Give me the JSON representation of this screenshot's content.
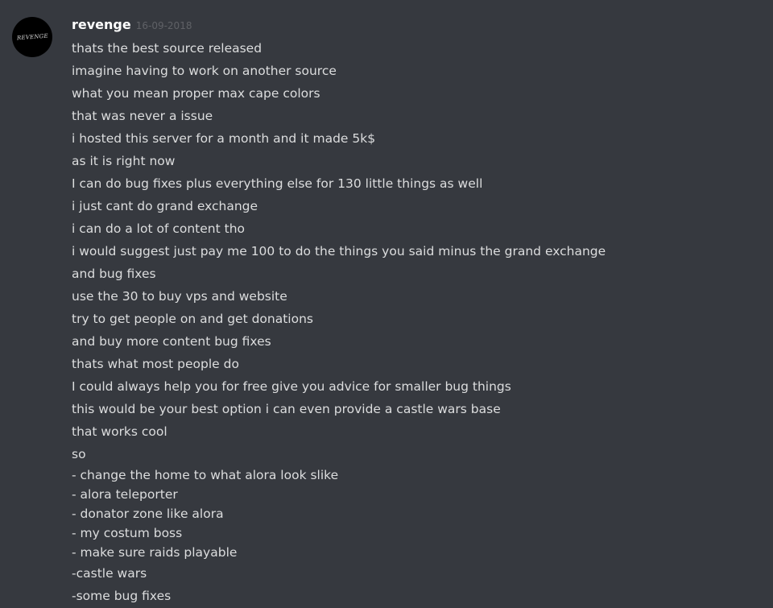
{
  "message": {
    "username": "revenge",
    "timestamp": "16-09-2018",
    "avatar_logo_text": "REVENGE",
    "lines": [
      "thats the best source released",
      "imagine having to work on another source",
      "what you mean proper max cape colors",
      "that was never a issue",
      "i hosted this server for a month and it made 5k$",
      "as it is right now",
      "I can do bug fixes plus everything else for 130 little things as well",
      "i just cant do grand exchange",
      "i can do a lot of content tho",
      "i would suggest just pay me 100 to do the things you said minus the grand exchange",
      "and bug fixes",
      "use the 30 to buy vps and website",
      "try to get people on and get donations",
      "and buy more content bug fixes",
      "thats what most people do",
      "I could always help you for free give you advice for smaller bug things",
      "this would be your best option i can even provide a castle wars base",
      "that works cool",
      "so",
      "- change the home to what alora look slike\n- alora teleporter\n- donator zone like alora\n- my costum boss\n- make sure raids playable",
      "-castle wars",
      "-some bug fixes"
    ],
    "list_items": [
      "- change the home to what alora look slike",
      "- alora teleporter",
      "- donator zone like alora",
      "- my costum boss",
      "- make sure raids playable"
    ]
  }
}
